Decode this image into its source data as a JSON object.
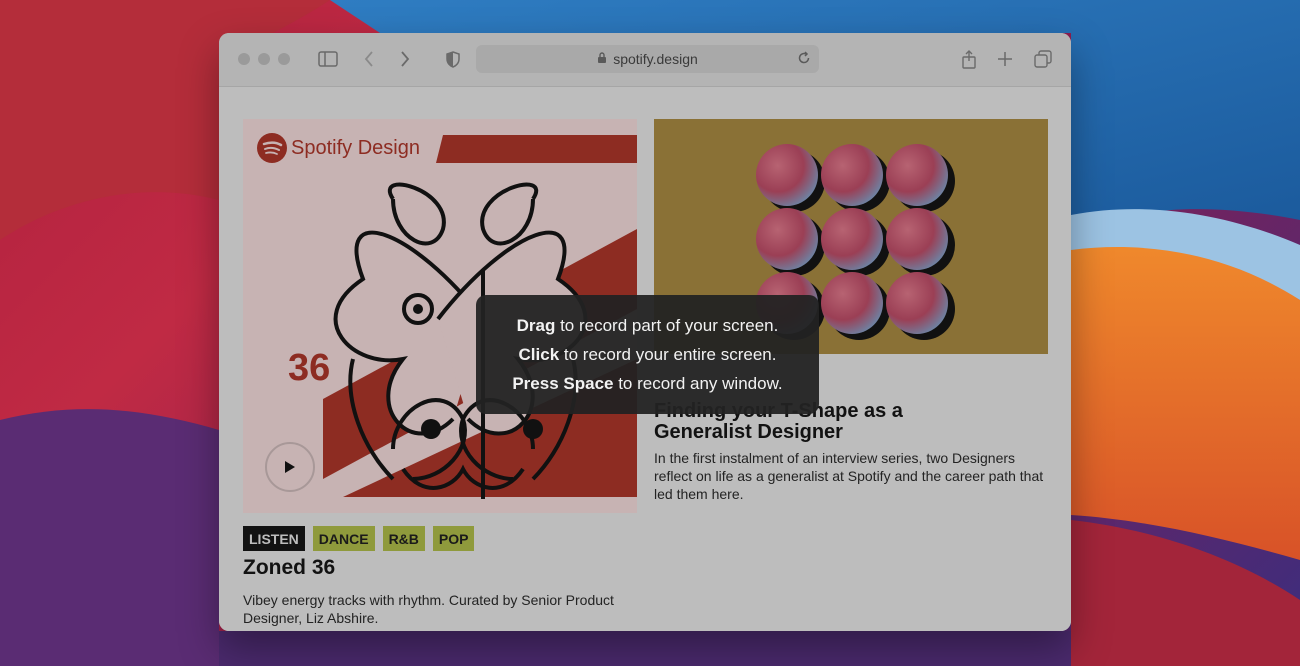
{
  "browser": {
    "url": "spotify.design"
  },
  "cards": {
    "left": {
      "brand": "Spotify Design",
      "number": "36",
      "tags": [
        "LISTEN",
        "DANCE",
        "R&B",
        "POP"
      ],
      "title": "Zoned 36",
      "description": "Vibey energy tracks with rhythm. Curated by Senior Product Designer, Liz Abshire."
    },
    "right": {
      "title": "Finding your T-Shape as a Generalist Designer",
      "description": "In the first instalment of an interview series, two Designers reflect on life as a generalist at Spotify and the career path that led them here."
    }
  },
  "overlay": {
    "line1_bold": "Drag",
    "line1_rest": " to record part of your screen.",
    "line2_bold": "Click",
    "line2_rest": " to record your entire screen.",
    "line3_bold": "Press Space",
    "line3_rest": " to record any window."
  },
  "colors": {
    "spotify_red": "#8d2c22",
    "tag_green": "#8f9a3c",
    "card_mustard": "#8a7136"
  },
  "icons": [
    "sidebar-icon",
    "back-icon",
    "forward-icon",
    "shield-icon",
    "lock-icon",
    "reload-icon",
    "share-icon",
    "new-tab-icon",
    "tabs-overview-icon",
    "play-icon"
  ]
}
